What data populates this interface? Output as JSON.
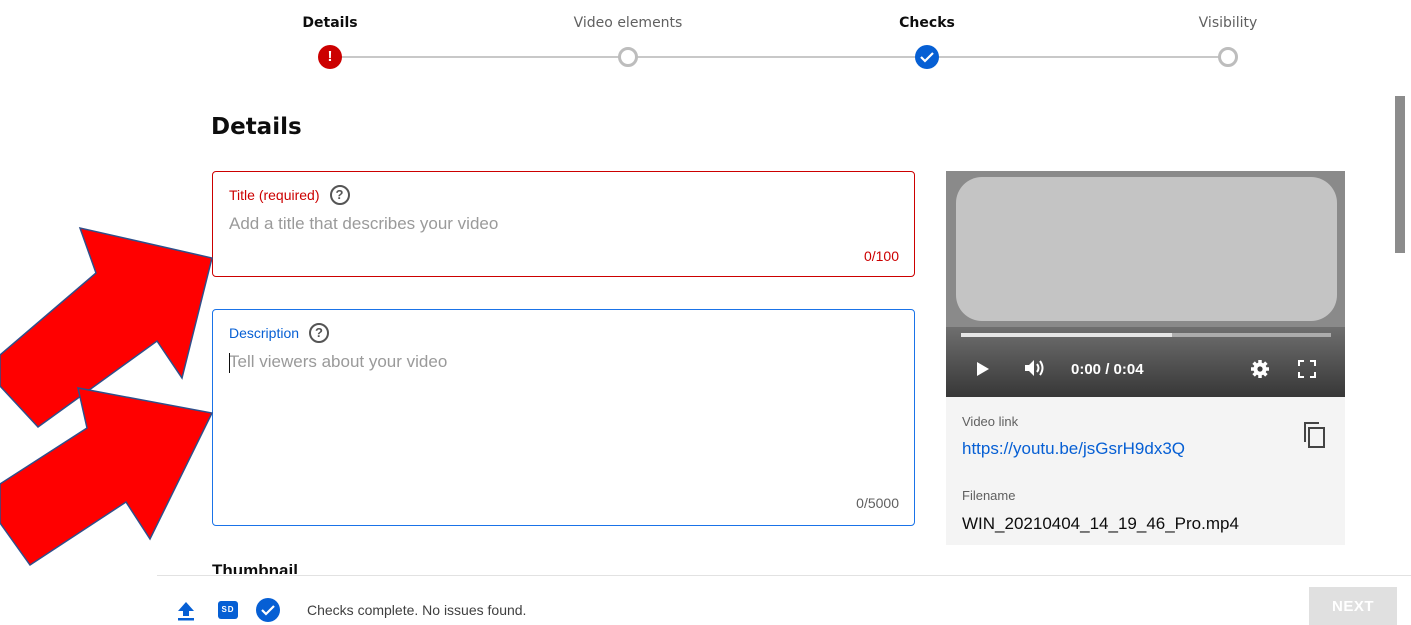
{
  "stepper": {
    "steps": [
      {
        "label": "Details",
        "state": "error",
        "icon": "exclamation-icon"
      },
      {
        "label": "Video elements",
        "state": "pending",
        "icon": "empty-circle-icon"
      },
      {
        "label": "Checks",
        "state": "done",
        "icon": "check-icon"
      },
      {
        "label": "Visibility",
        "state": "pending",
        "icon": "empty-circle-icon"
      }
    ],
    "error_mark": "!"
  },
  "details": {
    "heading": "Details",
    "title_field": {
      "label": "Title (required)",
      "placeholder": "Add a title that describes your video",
      "value": "",
      "counter": "0/100",
      "help_icon": "?"
    },
    "description_field": {
      "label": "Description",
      "placeholder": "Tell viewers about your video",
      "value": "",
      "counter": "0/5000",
      "help_icon": "?"
    },
    "thumbnail_heading": "Thumbnail"
  },
  "preview": {
    "time": "0:00 / 0:04",
    "progress_fraction": 0.0,
    "buffered_fraction": 0.57,
    "video_link_label": "Video link",
    "video_link": "https://youtu.be/jsGsrH9dx3Q",
    "filename_label": "Filename",
    "filename": "WIN_20210404_14_19_46_Pro.mp4",
    "icons": [
      "play-icon",
      "volume-icon",
      "gear-icon",
      "fullscreen-icon",
      "copy-icon"
    ]
  },
  "footer": {
    "status": "Checks complete. No issues found.",
    "sd_badge": "SD",
    "next_label": "NEXT",
    "icons": [
      "upload-icon",
      "sd-icon",
      "check-icon"
    ]
  },
  "colors": {
    "error": "#cc0000",
    "accent": "#065fd4",
    "annotation_arrow": "#ff0000"
  }
}
